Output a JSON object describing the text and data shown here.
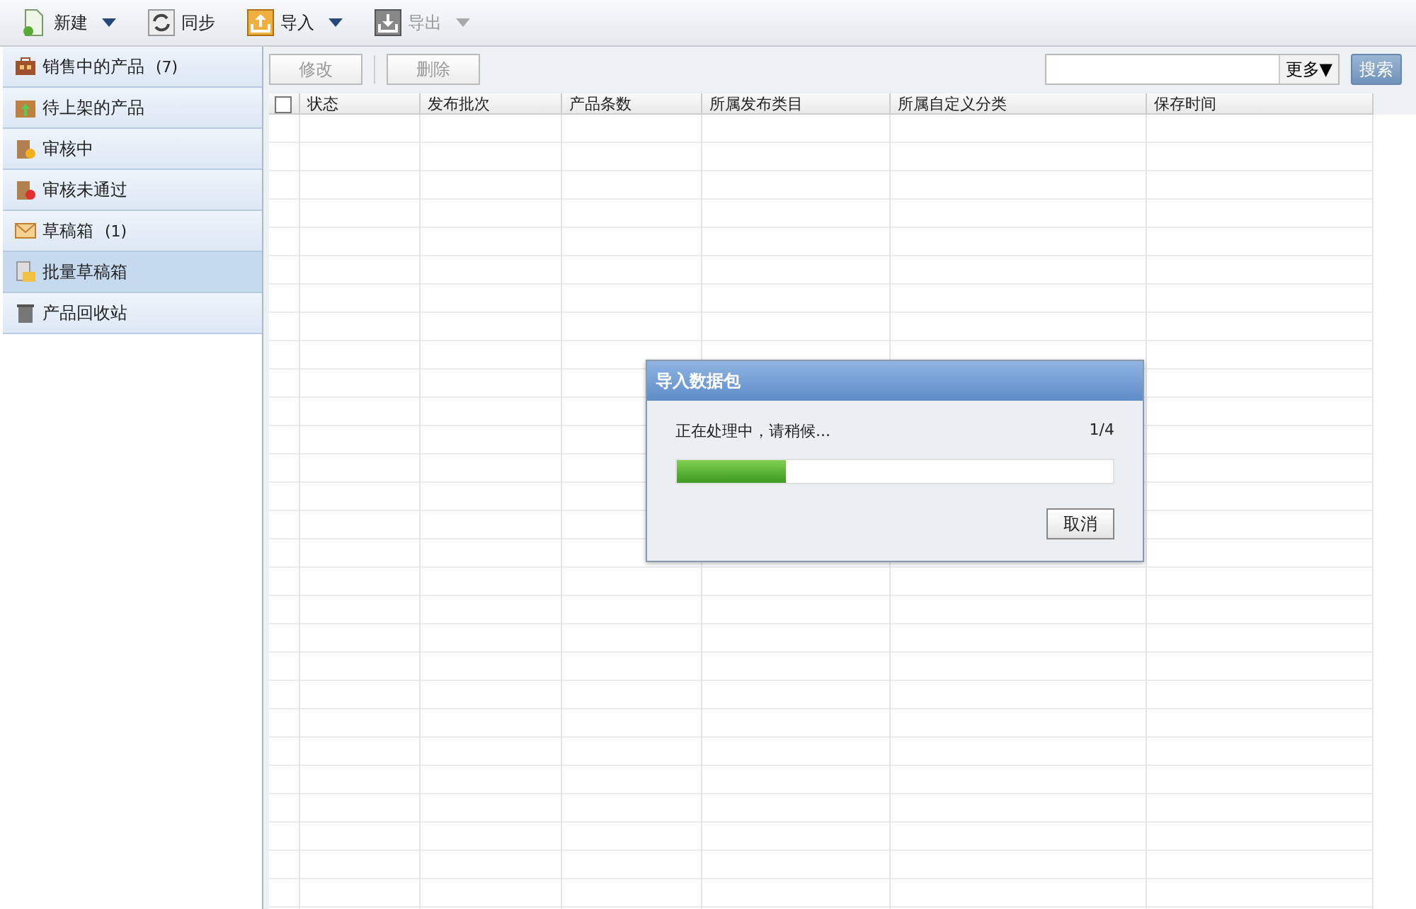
{
  "toolbar": [
    {
      "label": "新建",
      "kind": "new",
      "dropdown": true,
      "disabled": false
    },
    {
      "label": "同步",
      "kind": "sync",
      "dropdown": false,
      "disabled": false
    },
    {
      "label": "导入",
      "kind": "import",
      "dropdown": true,
      "disabled": false
    },
    {
      "label": "导出",
      "kind": "export",
      "dropdown": true,
      "disabled": true
    }
  ],
  "sidebar": {
    "items": [
      {
        "label": "销售中的产品",
        "count": "(7)",
        "kind": "briefcase",
        "selected": false
      },
      {
        "label": "待上架的产品",
        "kind": "shelf",
        "selected": false
      },
      {
        "label": "审核中",
        "kind": "review",
        "selected": false
      },
      {
        "label": "审核未通过",
        "kind": "rejected",
        "selected": false
      },
      {
        "label": "草稿箱",
        "count": "(1)",
        "kind": "mail",
        "selected": false
      },
      {
        "label": "批量草稿箱",
        "kind": "folder",
        "selected": true
      },
      {
        "label": "产品回收站",
        "kind": "trash",
        "selected": false
      }
    ]
  },
  "actions": [
    {
      "label": "修改",
      "disabled": true
    },
    {
      "label": "删除",
      "disabled": true
    }
  ],
  "search": {
    "more": "更多▼",
    "button": "搜索"
  },
  "table": {
    "select_all_checked": false,
    "columns": [
      "状态",
      "发布批次",
      "产品条数",
      "所属发布类目",
      "所属自定义分类",
      "保存时间"
    ]
  },
  "dialog": {
    "title": "导入数据包",
    "message": "正在处理中，请稍候...",
    "progress_text": "1/4",
    "level": 0.25,
    "button": "取消"
  }
}
